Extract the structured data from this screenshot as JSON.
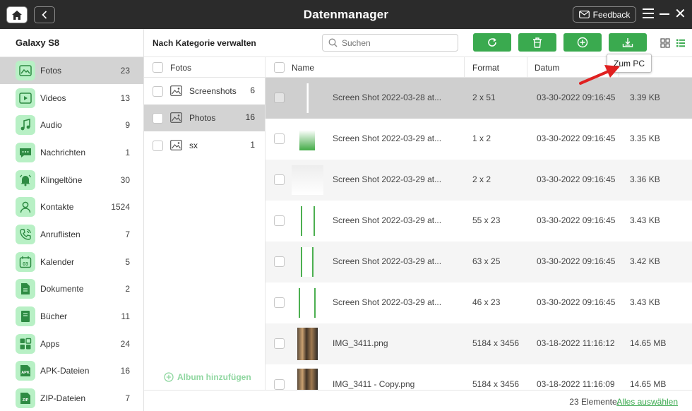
{
  "app": {
    "title": "Datenmanager",
    "feedback_label": "Feedback"
  },
  "colors": {
    "accent": "#3aaa4f",
    "icon_bg": "#b8f0c5",
    "titlebar": "#2b2b2b",
    "selected": "#d3d3d3"
  },
  "sidebar": {
    "device": "Galaxy S8",
    "items": [
      {
        "label": "Fotos",
        "count": "23",
        "icon": "photo-icon"
      },
      {
        "label": "Videos",
        "count": "13",
        "icon": "video-icon"
      },
      {
        "label": "Audio",
        "count": "9",
        "icon": "music-icon"
      },
      {
        "label": "Nachrichten",
        "count": "1",
        "icon": "message-icon"
      },
      {
        "label": "Klingeltöne",
        "count": "30",
        "icon": "bell-icon"
      },
      {
        "label": "Kontakte",
        "count": "1524",
        "icon": "contact-icon"
      },
      {
        "label": "Anruflisten",
        "count": "7",
        "icon": "phone-icon"
      },
      {
        "label": "Kalender",
        "count": "5",
        "icon": "calendar-icon"
      },
      {
        "label": "Dokumente",
        "count": "2",
        "icon": "document-icon"
      },
      {
        "label": "Bücher",
        "count": "11",
        "icon": "book-icon"
      },
      {
        "label": "Apps",
        "count": "24",
        "icon": "apps-icon"
      },
      {
        "label": "APK-Dateien",
        "count": "16",
        "icon": "apk-icon"
      },
      {
        "label": "ZIP-Dateien",
        "count": "7",
        "icon": "zip-icon"
      }
    ],
    "calendar_day": "03",
    "apk_text": "APK",
    "zip_text": "ZIP"
  },
  "toolbar": {
    "label": "Nach Kategorie verwalten",
    "search_placeholder": "Suchen",
    "tooltip": "Zum PC"
  },
  "albums": {
    "header": "Fotos",
    "items": [
      {
        "label": "Screenshots",
        "count": "6"
      },
      {
        "label": "Photos",
        "count": "16"
      },
      {
        "label": "sx",
        "count": "1"
      }
    ],
    "add_label": "Album hinzufügen"
  },
  "table": {
    "columns": [
      "Name",
      "Format",
      "Datum"
    ],
    "rows": [
      {
        "name": "Screen Shot 2022-03-28 at...",
        "format": "2 x 51",
        "date": "03-30-2022 09:16:45",
        "size": "3.39 KB"
      },
      {
        "name": "Screen Shot 2022-03-29 at...",
        "format": "1 x 2",
        "date": "03-30-2022 09:16:45",
        "size": "3.35 KB"
      },
      {
        "name": "Screen Shot 2022-03-29 at...",
        "format": "2 x 2",
        "date": "03-30-2022 09:16:45",
        "size": "3.36 KB"
      },
      {
        "name": "Screen Shot 2022-03-29 at...",
        "format": "55 x 23",
        "date": "03-30-2022 09:16:45",
        "size": "3.43 KB"
      },
      {
        "name": "Screen Shot 2022-03-29 at...",
        "format": "63 x 25",
        "date": "03-30-2022 09:16:45",
        "size": "3.42 KB"
      },
      {
        "name": "Screen Shot 2022-03-29 at...",
        "format": "46 x 23",
        "date": "03-30-2022 09:16:45",
        "size": "3.43 KB"
      },
      {
        "name": "IMG_3411.png",
        "format": "5184 x 3456",
        "date": "03-18-2022 11:16:12",
        "size": "14.65 MB"
      },
      {
        "name": "IMG_3411 - Copy.png",
        "format": "5184 x 3456",
        "date": "03-18-2022 11:16:09",
        "size": "14.65 MB"
      }
    ]
  },
  "footer": {
    "count": "23 Elemente.",
    "select_all": "Alles auswählen"
  }
}
